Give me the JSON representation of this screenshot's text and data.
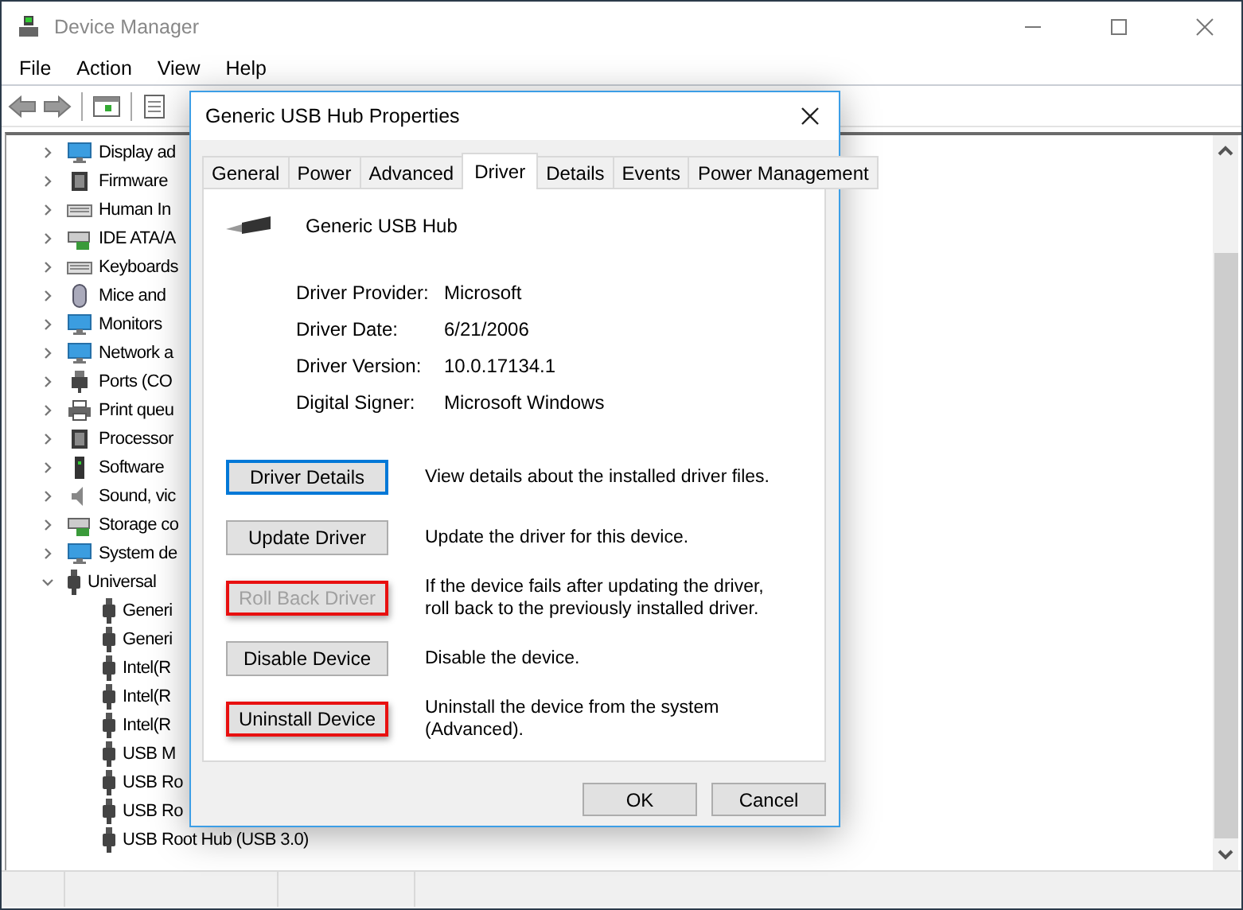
{
  "window": {
    "title": "Device Manager"
  },
  "menu": [
    "File",
    "Action",
    "View",
    "Help"
  ],
  "tree": [
    {
      "label": "Display ad",
      "expanded": false
    },
    {
      "label": "Firmware",
      "expanded": false
    },
    {
      "label": "Human In",
      "expanded": false
    },
    {
      "label": "IDE ATA/A",
      "expanded": false
    },
    {
      "label": "Keyboards",
      "expanded": false
    },
    {
      "label": "Mice and",
      "expanded": false
    },
    {
      "label": "Monitors",
      "expanded": false
    },
    {
      "label": "Network a",
      "expanded": false
    },
    {
      "label": "Ports (CO",
      "expanded": false
    },
    {
      "label": "Print queu",
      "expanded": false
    },
    {
      "label": "Processor",
      "expanded": false
    },
    {
      "label": "Software",
      "expanded": false
    },
    {
      "label": "Sound, vic",
      "expanded": false
    },
    {
      "label": "Storage co",
      "expanded": false
    },
    {
      "label": "System de",
      "expanded": false
    },
    {
      "label": "Universal",
      "expanded": true,
      "children": [
        {
          "label": "Generi"
        },
        {
          "label": "Generi"
        },
        {
          "label": "Intel(R"
        },
        {
          "label": "Intel(R"
        },
        {
          "label": "Intel(R"
        },
        {
          "label": "USB M"
        },
        {
          "label": "USB Ro"
        },
        {
          "label": "USB Ro"
        },
        {
          "label": "USB Root Hub (USB 3.0)"
        }
      ]
    }
  ],
  "dialog": {
    "title": "Generic USB Hub Properties",
    "tabs": [
      {
        "label": "General",
        "selected": false
      },
      {
        "label": "Power",
        "selected": false
      },
      {
        "label": "Advanced",
        "selected": false
      },
      {
        "label": "Driver",
        "selected": true
      },
      {
        "label": "Details",
        "selected": false
      },
      {
        "label": "Events",
        "selected": false
      },
      {
        "label": "Power Management",
        "selected": false
      }
    ],
    "device_name": "Generic USB Hub",
    "info": [
      {
        "label": "Driver Provider:",
        "value": "Microsoft"
      },
      {
        "label": "Driver Date:",
        "value": "6/21/2006"
      },
      {
        "label": "Driver Version:",
        "value": "10.0.17134.1"
      },
      {
        "label": "Digital Signer:",
        "value": "Microsoft Windows"
      }
    ],
    "actions": [
      {
        "button": "Driver Details",
        "description": "View details about the installed driver files.",
        "focused": true,
        "disabled": false,
        "highlighted": false
      },
      {
        "button": "Update Driver",
        "description": "Update the driver for this device.",
        "focused": false,
        "disabled": false,
        "highlighted": false
      },
      {
        "button": "Roll Back Driver",
        "description": "If the device fails after updating the driver, roll back to the previously installed driver.",
        "focused": false,
        "disabled": true,
        "highlighted": true
      },
      {
        "button": "Disable Device",
        "description": "Disable the device.",
        "focused": false,
        "disabled": false,
        "highlighted": false
      },
      {
        "button": "Uninstall Device",
        "description": "Uninstall the device from the system (Advanced).",
        "focused": false,
        "disabled": false,
        "highlighted": true
      }
    ],
    "buttons": [
      "OK",
      "Cancel"
    ]
  }
}
